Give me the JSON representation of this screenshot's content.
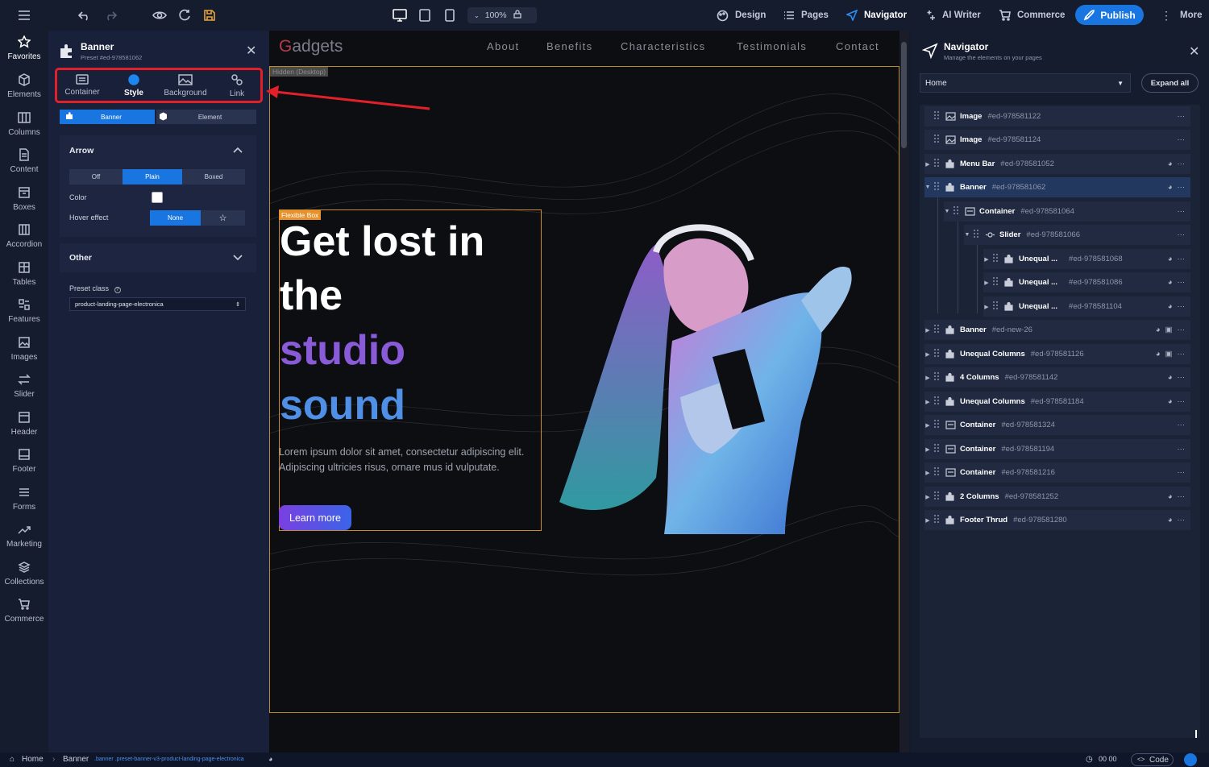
{
  "topbar": {
    "zoom": "100%",
    "design": "Design",
    "pages": "Pages",
    "navigator": "Navigator",
    "ai_writer": "AI Writer",
    "commerce": "Commerce",
    "publish": "Publish",
    "more": "More"
  },
  "rail": {
    "favorites": "Favorites",
    "elements": "Elements",
    "columns": "Columns",
    "content": "Content",
    "boxes": "Boxes",
    "accordion": "Accordion",
    "tables": "Tables",
    "features": "Features",
    "images": "Images",
    "slider": "Slider",
    "header": "Header",
    "footer": "Footer",
    "forms": "Forms",
    "marketing": "Marketing",
    "collections": "Collections",
    "commerce": "Commerce"
  },
  "panel": {
    "title": "Banner",
    "subtitle": "Preset #ed-978581062",
    "tabs": {
      "container": "Container",
      "style": "Style",
      "background": "Background",
      "link": "Link"
    },
    "target": {
      "banner": "Banner",
      "element": "Element"
    },
    "arrow": {
      "title": "Arrow",
      "options": {
        "off": "Off",
        "plain": "Plain",
        "boxed": "Boxed"
      },
      "color_label": "Color",
      "hover_label": "Hover effect",
      "hover_value": "None"
    },
    "other_title": "Other",
    "preset_label": "Preset class",
    "preset_value": "product-landing-page-electronica"
  },
  "site": {
    "logo_initial": "G",
    "logo_rest": "adgets",
    "nav": {
      "about": "About",
      "benefits": "Benefits",
      "characteristics": "Characteristics",
      "testimonials": "Testimonials",
      "contact": "Contact"
    },
    "hidden_tag": "Hidden (Desktop)",
    "flex_tag": "Flexible Box",
    "hero": {
      "line1": "Get lost in",
      "line2": "the",
      "line3": "studio",
      "line4": "sound"
    },
    "paragraph": "Lorem ipsum dolor sit amet, consectetur adipiscing elit. Adipiscing ultricies risus, ornare mus id vulputate.",
    "cta": "Learn more"
  },
  "navigator": {
    "title": "Navigator",
    "subtitle": "Manage the elements on your pages",
    "page_select": "Home",
    "expand_all": "Expand all",
    "rows": {
      "r0": {
        "name": "Image",
        "id": "#ed-978581122"
      },
      "r1": {
        "name": "Image",
        "id": "#ed-978581124"
      },
      "r2": {
        "name": "Menu Bar",
        "id": "#ed-978581052"
      },
      "r3": {
        "name": "Banner",
        "id": "#ed-978581062"
      },
      "r4": {
        "name": "Container",
        "id": "#ed-978581064"
      },
      "r5": {
        "name": "Slider",
        "id": "#ed-978581066"
      },
      "r6": {
        "name": "Unequal ...",
        "id": "#ed-978581068"
      },
      "r7": {
        "name": "Unequal ...",
        "id": "#ed-978581086"
      },
      "r8": {
        "name": "Unequal ...",
        "id": "#ed-978581104"
      },
      "r9": {
        "name": "Banner",
        "id": "#ed-new-26"
      },
      "r10": {
        "name": "Unequal Columns",
        "id": "#ed-978581126"
      },
      "r11": {
        "name": "4 Columns",
        "id": "#ed-978581142"
      },
      "r12": {
        "name": "Unequal Columns",
        "id": "#ed-978581184"
      },
      "r13": {
        "name": "Container",
        "id": "#ed-978581324"
      },
      "r14": {
        "name": "Container",
        "id": "#ed-978581194"
      },
      "r15": {
        "name": "Container",
        "id": "#ed-978581216"
      },
      "r16": {
        "name": "2 Columns",
        "id": "#ed-978581252"
      },
      "r17": {
        "name": "Footer Thrud",
        "id": "#ed-978581280"
      }
    }
  },
  "status": {
    "home": "Home",
    "banner": "Banner",
    "classes": ".banner .preset-banner-v3-product-landing-page-electronica",
    "time": "00 00",
    "code": "Code"
  },
  "colors": {
    "accent": "#1976e0",
    "highlight": "#e2202a",
    "frame": "#c88b2d"
  }
}
